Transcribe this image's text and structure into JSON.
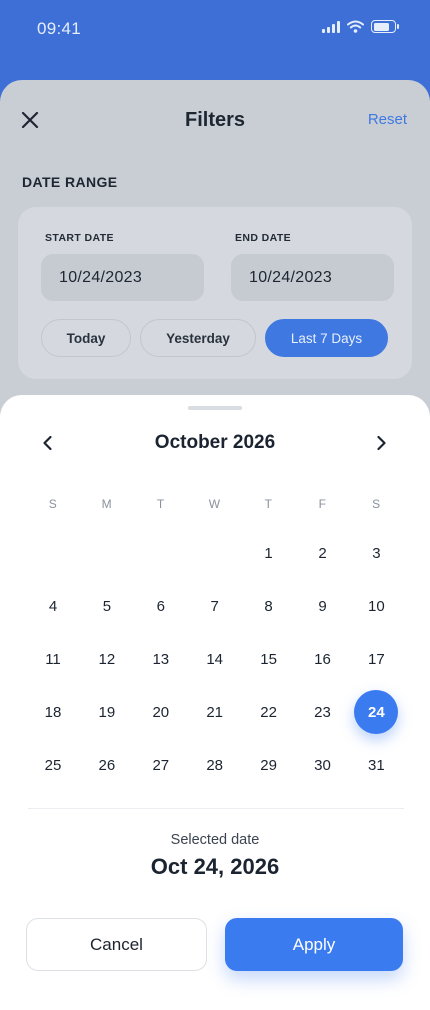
{
  "status_bar": {
    "time": "09:41",
    "icons": [
      "signal-icon",
      "wifi-icon",
      "battery-icon"
    ]
  },
  "filters": {
    "title": "Filters",
    "reset_label": "Reset",
    "close_icon": "close-icon",
    "date_range": {
      "label": "DATE RANGE",
      "start_label": "START DATE",
      "start_value": "10/24/2023",
      "end_label": "END DATE",
      "end_value": "10/24/2023",
      "chips": [
        {
          "label": "Today",
          "active": false
        },
        {
          "label": "Yesterday",
          "active": false
        },
        {
          "label": "Last 7 Days",
          "active": true
        }
      ]
    }
  },
  "calendar": {
    "month_label": "October 2026",
    "prev_icon": "chevron-left-icon",
    "next_icon": "chevron-right-icon",
    "weekdays": [
      "S",
      "M",
      "T",
      "W",
      "T",
      "F",
      "S"
    ],
    "first_weekday_index": 4,
    "days_in_month": 31,
    "selected_day": 24
  },
  "selection": {
    "caption": "Selected date",
    "value": "Oct 24, 2026"
  },
  "actions": {
    "cancel_label": "Cancel",
    "apply_label": "Apply"
  },
  "colors": {
    "primary": "#3b7bf0",
    "header_blue": "#3d6fd6",
    "overlay_sheet": "#c9ced5",
    "text_dark": "#1b2430"
  }
}
